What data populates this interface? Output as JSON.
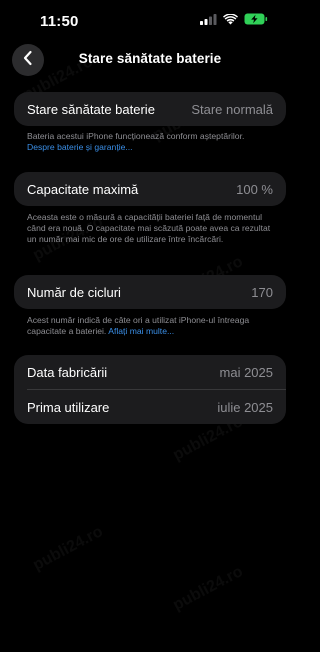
{
  "status_bar": {
    "time": "11:50",
    "icons": [
      "cellular-signal-icon",
      "wifi-icon",
      "battery-charging-icon"
    ]
  },
  "nav": {
    "title": "Stare sănătate baterie",
    "back_icon": "chevron-left-icon"
  },
  "health_card": {
    "label": "Stare sănătate baterie",
    "value": "Stare normală"
  },
  "health_footnote": {
    "text": "Bateria acestui iPhone funcționează conform așteptărilor.",
    "link": "Despre baterie și garanție..."
  },
  "capacity_card": {
    "label": "Capacitate maximă",
    "value": "100 %"
  },
  "capacity_footnote": {
    "text": "Aceasta este o măsură a capacității bateriei față de momentul când era nouă. O capacitate mai scăzută poate avea ca rezultat un număr mai mic de ore de utilizare între încărcări."
  },
  "cycles_card": {
    "label": "Număr de cicluri",
    "value": "170"
  },
  "cycles_footnote": {
    "text": "Acest număr indică de câte ori a utilizat iPhone-ul întreaga capacitate a bateriei.",
    "link": "Aflați mai multe..."
  },
  "dates_card": {
    "manufacture_label": "Data fabricării",
    "manufacture_value": "mai 2025",
    "first_use_label": "Prima utilizare",
    "first_use_value": "iulie 2025"
  },
  "watermark": "publi24.ro",
  "colors": {
    "background": "#000000",
    "card": "#1c1c1e",
    "secondary_text": "#8e8e93",
    "link": "#3a8ee6",
    "battery_charging": "#30d158"
  }
}
